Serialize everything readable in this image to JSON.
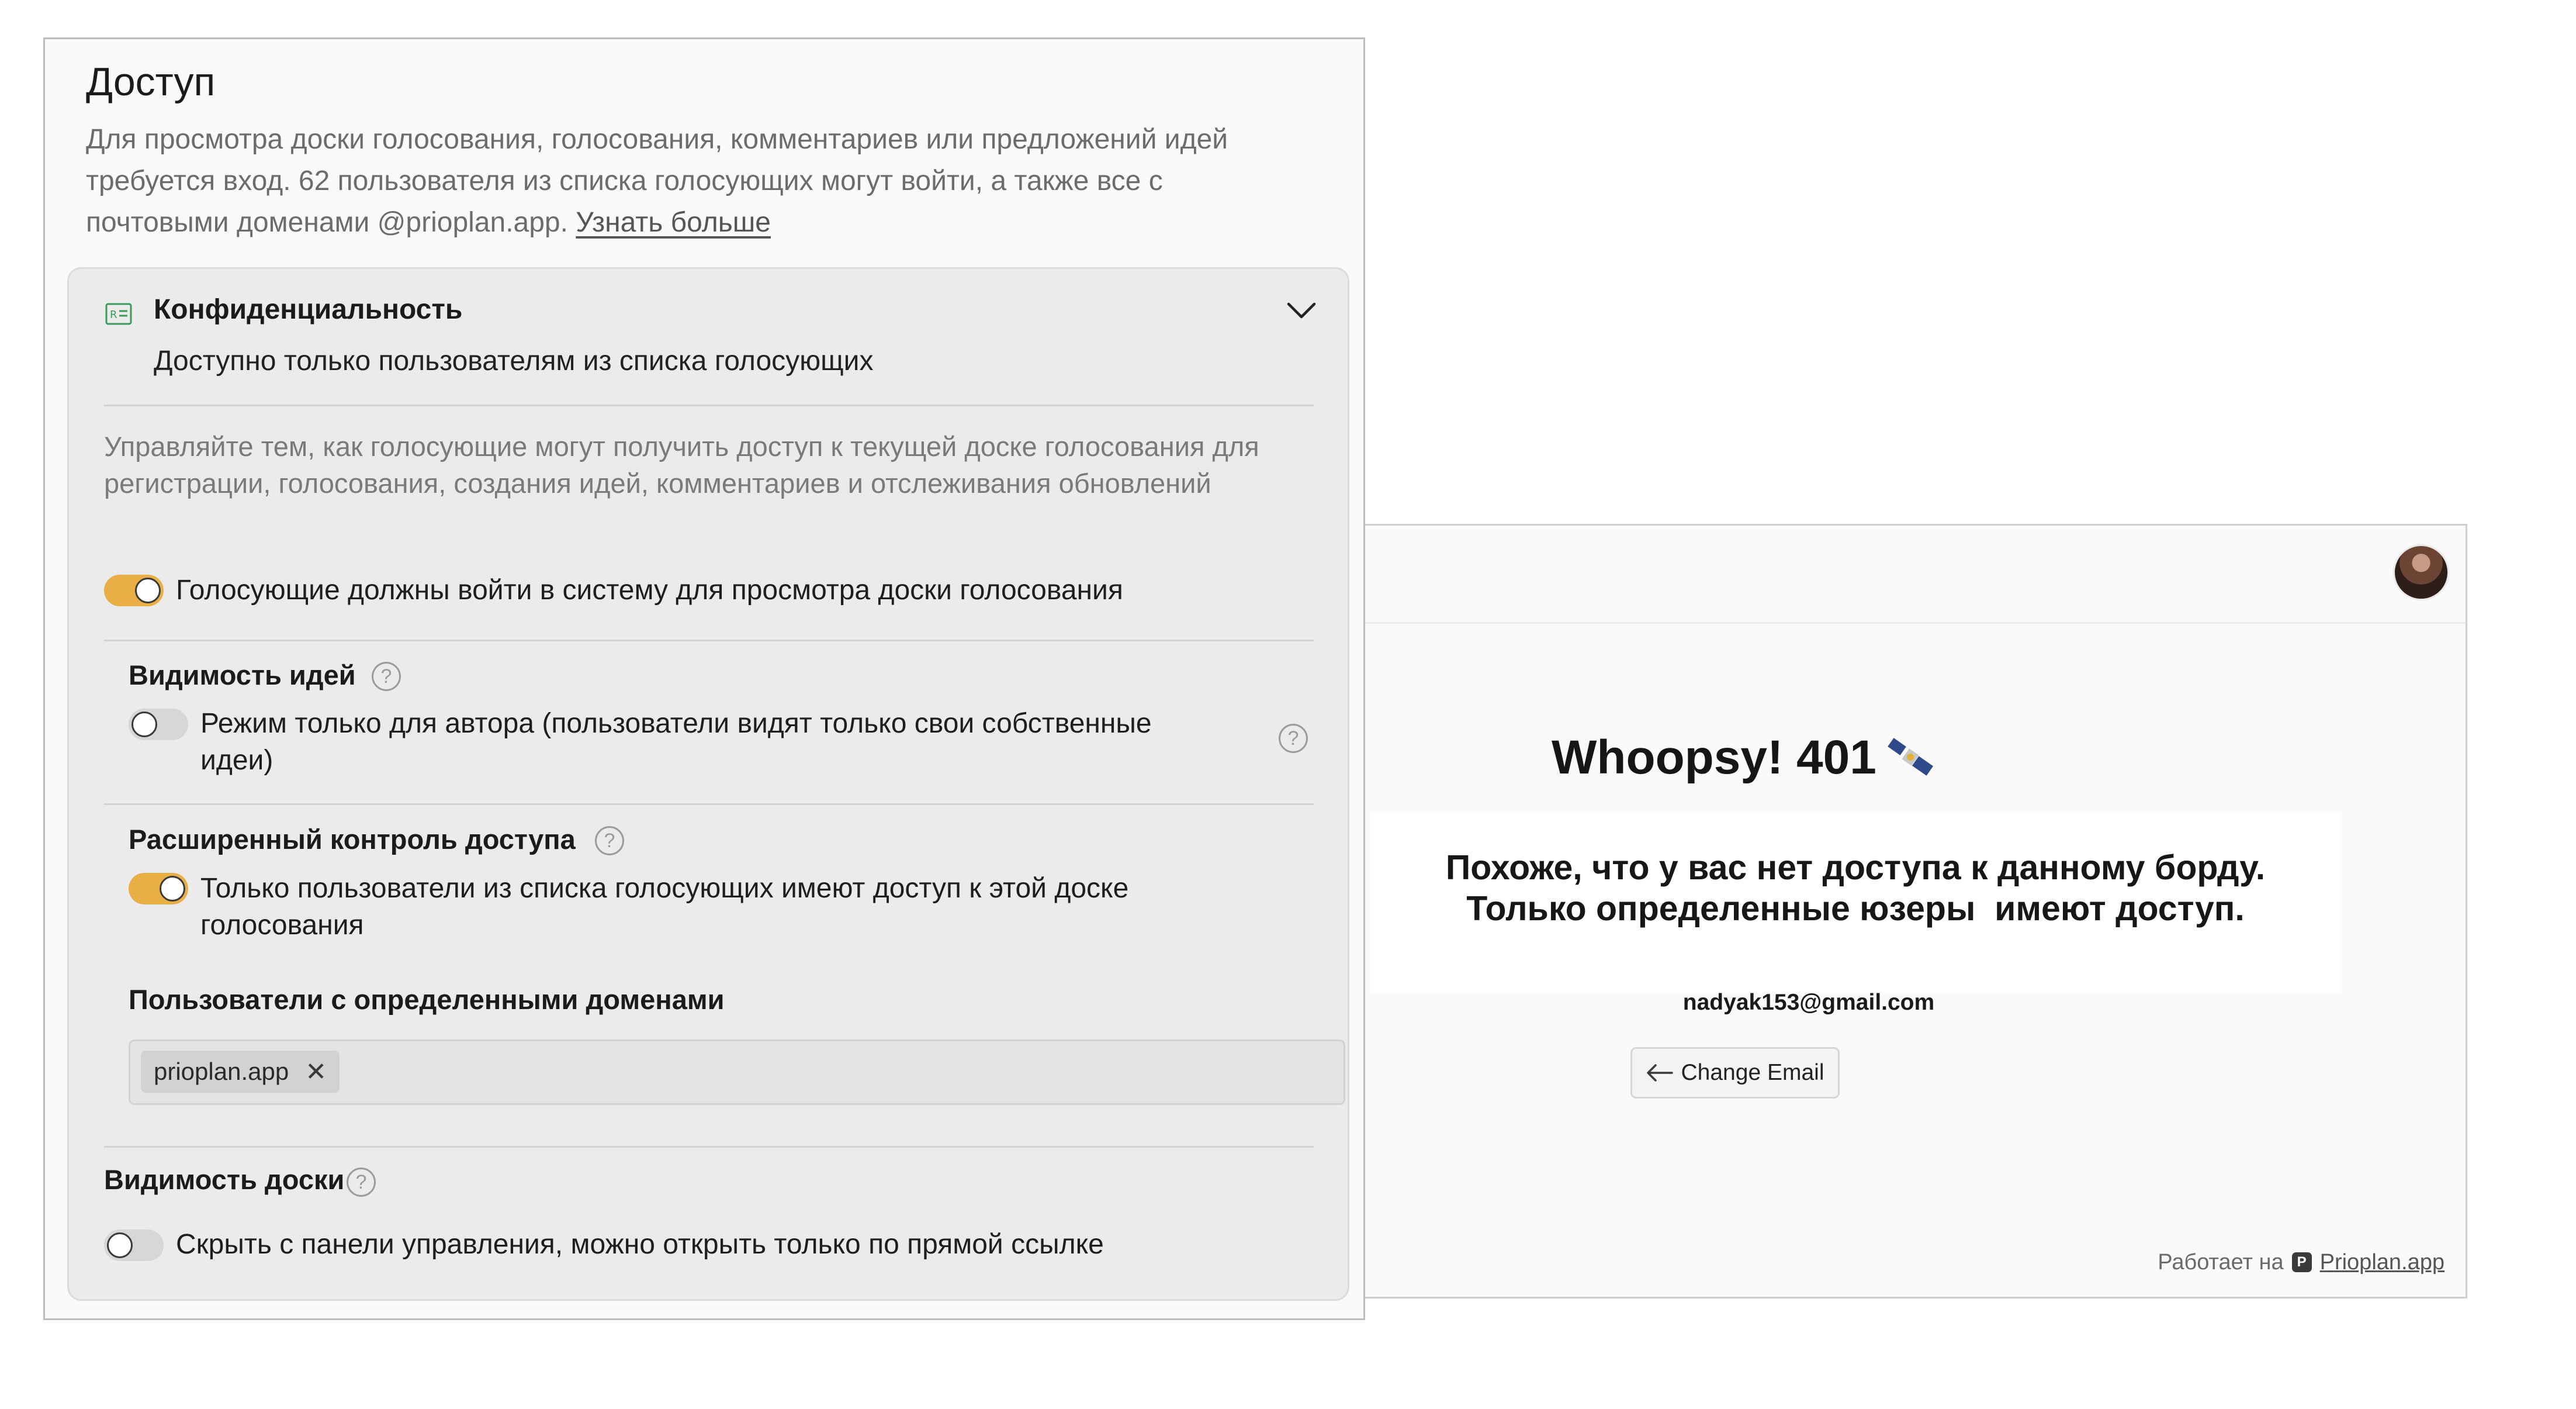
{
  "settings": {
    "title": "Доступ",
    "description": "Для просмотра доски голосования, голосования, комментариев или предложений идей требуется вход. 62 пользователя из списка голосующих могут войти, а также все с почтовыми доменами @prioplan.app.",
    "learn_more": "Узнать больше",
    "privacy": {
      "title": "Конфиденциальность",
      "subtitle": "Доступно только пользователям из списка голосующих",
      "help_text": "Управляйте тем, как голосующие могут получить доступ к текущей доске голосования для регистрации, голосования, создания идей, комментариев и отслеживания обновлений",
      "login_required": {
        "label": "Голосующие должны войти в систему для просмотра доски голосования",
        "enabled": true
      },
      "ideas_visibility": {
        "title": "Видимость идей",
        "author_only_label": "Режим только для автора (пользователи видят только свои собственные идеи)",
        "enabled": false
      },
      "advanced_access": {
        "title": "Расширенный контроль доступа",
        "label": "Только пользователи из списка голосующих имеют доступ к этой доске голосования",
        "enabled": true
      },
      "domains": {
        "title": "Пользователи с определенными доменами",
        "chips": [
          "prioplan.app"
        ]
      },
      "board_visibility": {
        "title": "Видимость доски",
        "label": "Скрыть с панели управления, можно открыть только по прямой ссылке",
        "enabled": false
      }
    }
  },
  "error_page": {
    "title": "Whoopsy! 401",
    "message_line1": "Похоже, что у вас нет доступа к данному борду.",
    "message_line2": "Только определенные юзеры  имеют доступ.",
    "email": "nadyak153@gmail.com",
    "change_email": "Change Email",
    "powered_by": "Работает на",
    "powered_link": "Prioplan.app"
  },
  "colors": {
    "toggle_on": "#eaae47",
    "card_background": "#ebebeb",
    "privacy_icon": "#3a9a5a"
  },
  "icons": [
    "privacy-badge-icon",
    "chevron-down-icon",
    "help-icon",
    "close-icon",
    "satellite-icon",
    "arrow-left-icon",
    "prioplan-logo-icon"
  ]
}
